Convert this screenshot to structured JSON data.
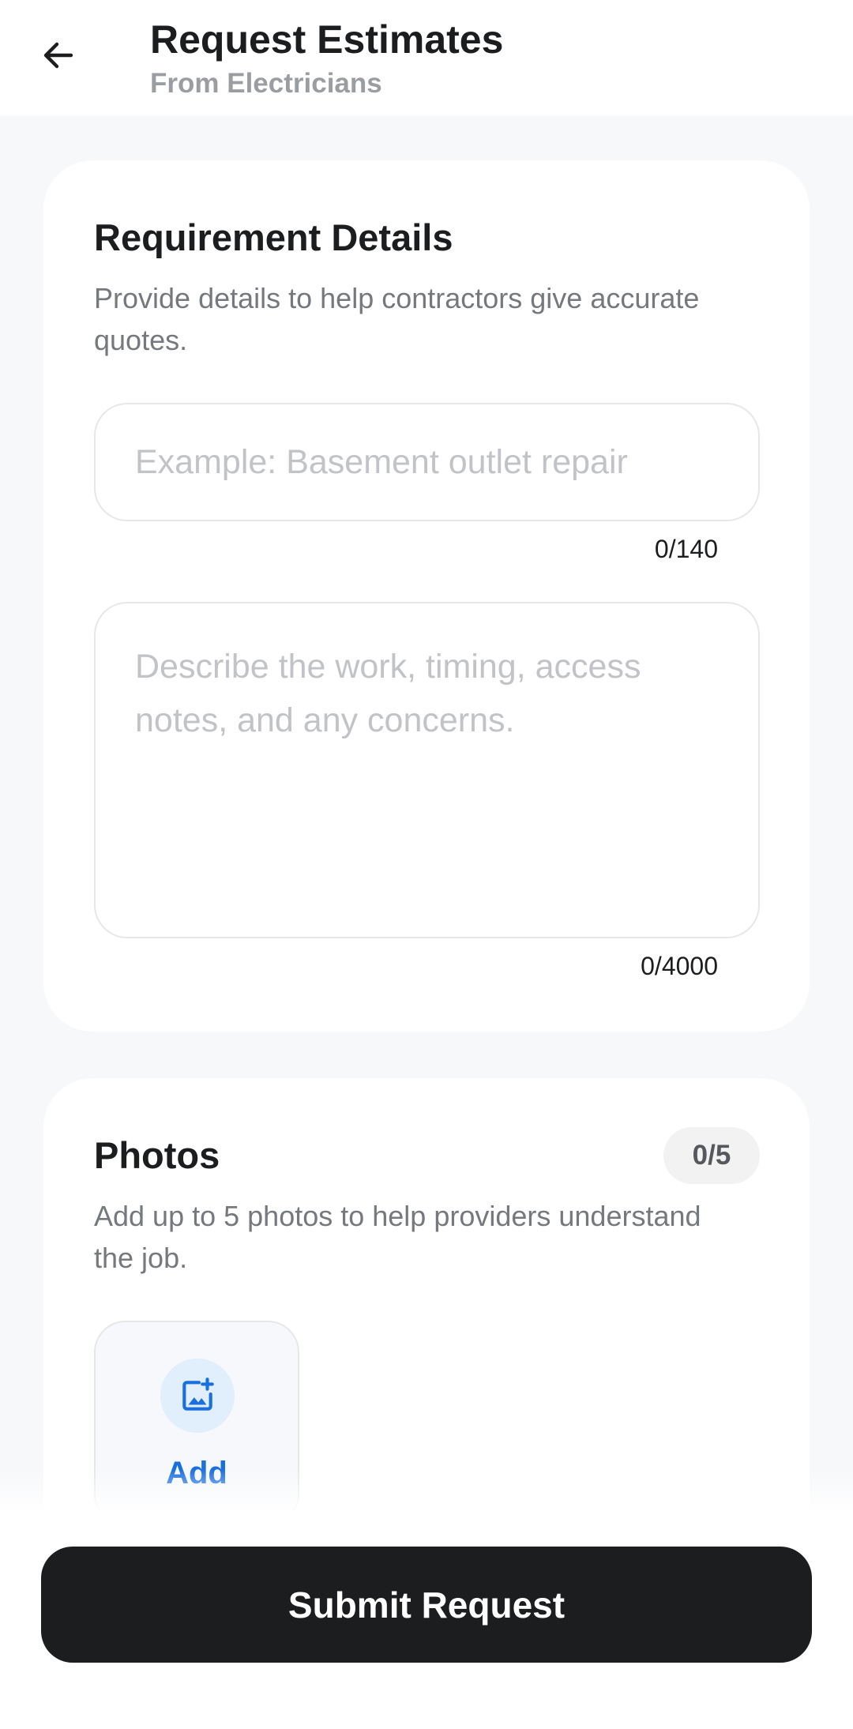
{
  "header": {
    "title": "Request Estimates",
    "subtitle": "From Electricians",
    "back_icon": "arrow-left-icon"
  },
  "details_card": {
    "title": "Requirement Details",
    "description": "Provide details to help contractors give accurate quotes.",
    "title_field": {
      "value": "",
      "placeholder": "Example: Basement outlet repair",
      "counter": "0/140"
    },
    "description_field": {
      "value": "",
      "placeholder": "Describe the work, timing, access notes, and any concerns.",
      "counter": "0/4000"
    }
  },
  "photos_card": {
    "title": "Photos",
    "count_badge": "0/5",
    "description": "Add up to 5 photos to help providers understand the job.",
    "add_tile": {
      "label": "Add",
      "icon": "add-photo-icon"
    }
  },
  "footer": {
    "submit_label": "Submit Request"
  },
  "colors": {
    "accent": "#1a6fe0",
    "primary_button": "#1b1d1f",
    "background": "#f7f8fa"
  }
}
